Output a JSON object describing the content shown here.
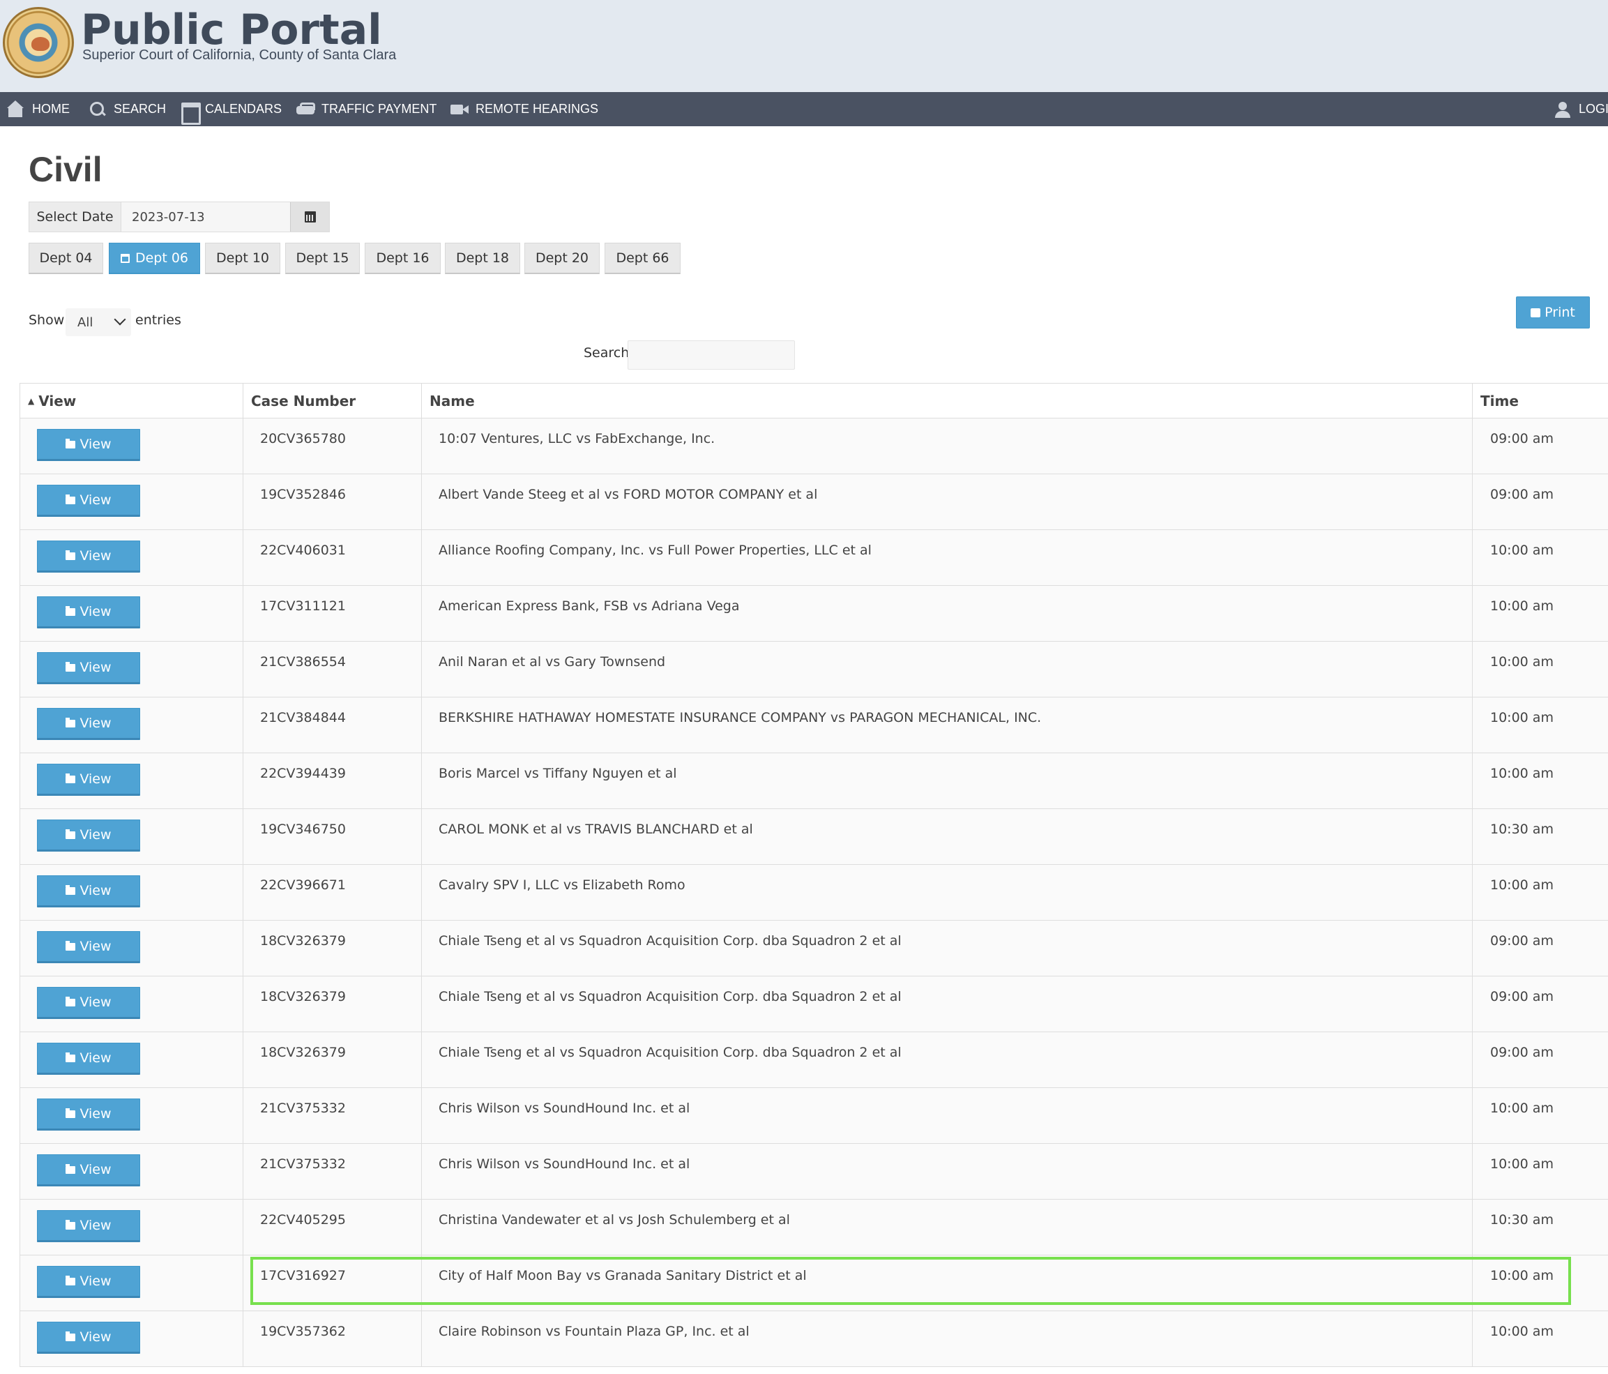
{
  "header": {
    "title": "Public Portal",
    "subtitle": "Superior Court of California, County of Santa Clara"
  },
  "nav": {
    "home": "HOME",
    "search": "SEARCH",
    "calendars": "CALENDARS",
    "traffic": "TRAFFIC PAYMENT",
    "remote": "REMOTE HEARINGS",
    "login": "LOGI"
  },
  "page": {
    "title": "Civil",
    "date_label": "Select Date",
    "date_value": "2023-07-13"
  },
  "depts": [
    "Dept 04",
    "Dept 06",
    "Dept 10",
    "Dept 15",
    "Dept 16",
    "Dept 18",
    "Dept 20",
    "Dept 66"
  ],
  "active_dept": "Dept 06",
  "controls": {
    "show": "Show",
    "show_value": "All",
    "entries": "entries",
    "search_label": "Search:",
    "print": "Print"
  },
  "table": {
    "headers": [
      "View",
      "Case Number",
      "Name",
      "Time"
    ],
    "view_label": "View",
    "rows": [
      {
        "case": "20CV365780",
        "name": "10:07 Ventures, LLC vs FabExchange, Inc.",
        "time": "09:00 am"
      },
      {
        "case": "19CV352846",
        "name": "Albert Vande Steeg et al vs FORD MOTOR COMPANY et al",
        "time": "09:00 am"
      },
      {
        "case": "22CV406031",
        "name": "Alliance Roofing Company, Inc. vs Full Power Properties, LLC et al",
        "time": "10:00 am"
      },
      {
        "case": "17CV311121",
        "name": "American Express Bank, FSB vs Adriana Vega",
        "time": "10:00 am"
      },
      {
        "case": "21CV386554",
        "name": "Anil Naran et al vs Gary Townsend",
        "time": "10:00 am"
      },
      {
        "case": "21CV384844",
        "name": "BERKSHIRE HATHAWAY HOMESTATE INSURANCE COMPANY vs PARAGON MECHANICAL, INC.",
        "time": "10:00 am"
      },
      {
        "case": "22CV394439",
        "name": "Boris Marcel vs Tiffany Nguyen et al",
        "time": "10:00 am"
      },
      {
        "case": "19CV346750",
        "name": "CAROL MONK et al vs TRAVIS BLANCHARD et al",
        "time": "10:30 am"
      },
      {
        "case": "22CV396671",
        "name": "Cavalry SPV I, LLC vs Elizabeth Romo",
        "time": "10:00 am"
      },
      {
        "case": "18CV326379",
        "name": "Chiale Tseng et al vs Squadron Acquisition Corp. dba Squadron 2 et al",
        "time": "09:00 am"
      },
      {
        "case": "18CV326379",
        "name": "Chiale Tseng et al vs Squadron Acquisition Corp. dba Squadron 2 et al",
        "time": "09:00 am"
      },
      {
        "case": "18CV326379",
        "name": "Chiale Tseng et al vs Squadron Acquisition Corp. dba Squadron 2 et al",
        "time": "09:00 am"
      },
      {
        "case": "21CV375332",
        "name": "Chris Wilson vs SoundHound Inc. et al",
        "time": "10:00 am"
      },
      {
        "case": "21CV375332",
        "name": "Chris Wilson vs SoundHound Inc. et al",
        "time": "10:00 am"
      },
      {
        "case": "22CV405295",
        "name": "Christina Vandewater et al vs Josh Schulemberg et al",
        "time": "10:30 am"
      },
      {
        "case": "17CV316927",
        "name": "City of Half Moon Bay vs Granada Sanitary District et al",
        "time": "10:00 am"
      },
      {
        "case": "19CV357362",
        "name": "Claire Robinson vs Fountain Plaza GP, Inc. et al",
        "time": "10:00 am"
      }
    ]
  },
  "colors": {
    "accent": "#4fa3d4",
    "nav_bg": "#4a5262",
    "header_bg": "#e3e9f0",
    "highlight": "#78e04e"
  }
}
